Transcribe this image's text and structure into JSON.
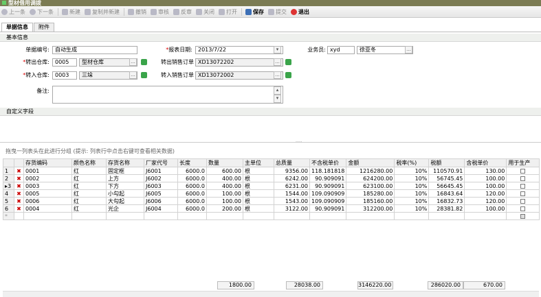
{
  "window": {
    "title": "型材借用调拨"
  },
  "toolbar": {
    "prev": "上一条",
    "next": "下一条",
    "new": "新建",
    "copy_new": "复制并新建",
    "revoke": "撤销",
    "approve": "审核",
    "unapprove": "反审",
    "close": "关闭",
    "open": "打开",
    "save": "保存",
    "submit": "提交",
    "exit": "退出"
  },
  "tabs": [
    "单据信息",
    "附件"
  ],
  "basic": {
    "section_title": "基本信息",
    "doc_no_label": "单据编号:",
    "doc_no": "自动生成",
    "date_label": "*报表日期:",
    "date": "2013/7/22",
    "staff_label": "业务员:",
    "staff_code": "xyd",
    "staff_name": "徐亚冬",
    "out_wh_label": "*转出仓库:",
    "out_wh_code": "0005",
    "out_wh_name": "型材仓库",
    "out_order_label": "转出销售订单",
    "out_order": "XD13072202",
    "in_wh_label": "*转入仓库:",
    "in_wh_code": "0003",
    "in_wh_name": "三垛",
    "in_order_label": "转入销售订单",
    "in_order": "XD13072002",
    "remark_label": "备注:"
  },
  "custom": {
    "section_title": "自定义字段"
  },
  "grid": {
    "hint": "拖曳一列表头在此进行分组 (提示: 列表行中点击右键可查看相关数据)",
    "columns": [
      "存货编码",
      "颜色名称",
      "存货名称",
      "厂家代号",
      "长度",
      "数量",
      "主单位",
      "总质量",
      "不含税单价",
      "金额",
      "税率(%)",
      "税额",
      "含税单价",
      "用于生产"
    ],
    "rows": [
      {
        "n": "1",
        "code": "0001",
        "color": "红",
        "name": "固定框",
        "factory": "J6001",
        "len": "6000.0",
        "qty": "600.00",
        "unit": "根",
        "weight": "9356.00",
        "price": "118.181818",
        "amount": "1216280.00",
        "rate": "10%",
        "tax": "110570.91",
        "tprice": "130.00"
      },
      {
        "n": "2",
        "code": "0002",
        "color": "红",
        "name": "上方",
        "factory": "J6002",
        "len": "6000.0",
        "qty": "400.00",
        "unit": "根",
        "weight": "6242.00",
        "price": "90.909091",
        "amount": "624200.00",
        "rate": "10%",
        "tax": "56745.45",
        "tprice": "100.00"
      },
      {
        "n": "▸3",
        "code": "0003",
        "color": "红",
        "name": "下方",
        "factory": "J6003",
        "len": "6000.0",
        "qty": "400.00",
        "unit": "根",
        "weight": "6231.00",
        "price": "90.909091",
        "amount": "623100.00",
        "rate": "10%",
        "tax": "56645.45",
        "tprice": "100.00"
      },
      {
        "n": "4",
        "code": "0005",
        "color": "红",
        "name": "小勾起",
        "factory": "J6005",
        "len": "6000.0",
        "qty": "100.00",
        "unit": "根",
        "weight": "1544.00",
        "price": "109.090909",
        "amount": "185280.00",
        "rate": "10%",
        "tax": "16843.64",
        "tprice": "120.00"
      },
      {
        "n": "5",
        "code": "0006",
        "color": "红",
        "name": "大勾起",
        "factory": "J6006",
        "len": "6000.0",
        "qty": "100.00",
        "unit": "根",
        "weight": "1543.00",
        "price": "109.090909",
        "amount": "185160.00",
        "rate": "10%",
        "tax": "16832.73",
        "tprice": "120.00"
      },
      {
        "n": "6",
        "code": "0004",
        "color": "红",
        "name": "光企",
        "factory": "J6004",
        "len": "6000.0",
        "qty": "200.00",
        "unit": "根",
        "weight": "3122.00",
        "price": "90.909091",
        "amount": "312200.00",
        "rate": "10%",
        "tax": "28381.82",
        "tprice": "100.00"
      }
    ],
    "newrow_marker": "*",
    "totals": {
      "qty": "1800.00",
      "weight": "28038.00",
      "amount": "3146220.00",
      "tax": "286020.00",
      "tprice": "670.00"
    }
  },
  "icons": {
    "delete": "delete-x-icon",
    "ellipsis": "..."
  },
  "colors": {
    "titlebar": "#7b7b53",
    "accent_green": "#3aa44a",
    "delete_red": "#cc0000"
  }
}
